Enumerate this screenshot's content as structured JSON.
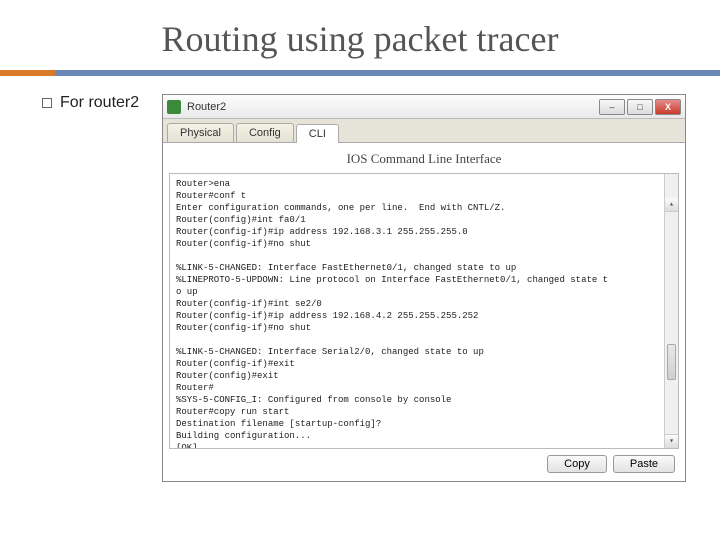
{
  "slide": {
    "title": "Routing using packet tracer",
    "bullet": "For router2"
  },
  "window": {
    "title": "Router2",
    "controls": {
      "min": "–",
      "max": "□",
      "close": "X"
    },
    "tabs": [
      "Physical",
      "Config",
      "CLI"
    ],
    "active_tab": 2,
    "panel_heading": "IOS Command Line Interface",
    "copy_label": "Copy",
    "paste_label": "Paste",
    "scroll": {
      "up": "▴",
      "down": "▾"
    }
  },
  "cli_lines": [
    "Router>ena",
    "Router#conf t",
    "Enter configuration commands, one per line.  End with CNTL/Z.",
    "Router(config)#int fa0/1",
    "Router(config-if)#ip address 192.168.3.1 255.255.255.0",
    "Router(config-if)#no shut",
    "",
    "%LINK-5-CHANGED: Interface FastEthernet0/1, changed state to up",
    "%LINEPROTO-5-UPDOWN: Line protocol on Interface FastEthernet0/1, changed state t",
    "o up",
    "Router(config-if)#int se2/0",
    "Router(config-if)#ip address 192.168.4.2 255.255.255.252",
    "Router(config-if)#no shut",
    "",
    "%LINK-5-CHANGED: Interface Serial2/0, changed state to up",
    "Router(config-if)#exit",
    "Router(config)#exit",
    "Router#",
    "%SYS-5-CONFIG_I: Configured from console by console",
    "Router#copy run start",
    "Destination filename [startup-config]?",
    "Building configuration...",
    "[OK]"
  ]
}
